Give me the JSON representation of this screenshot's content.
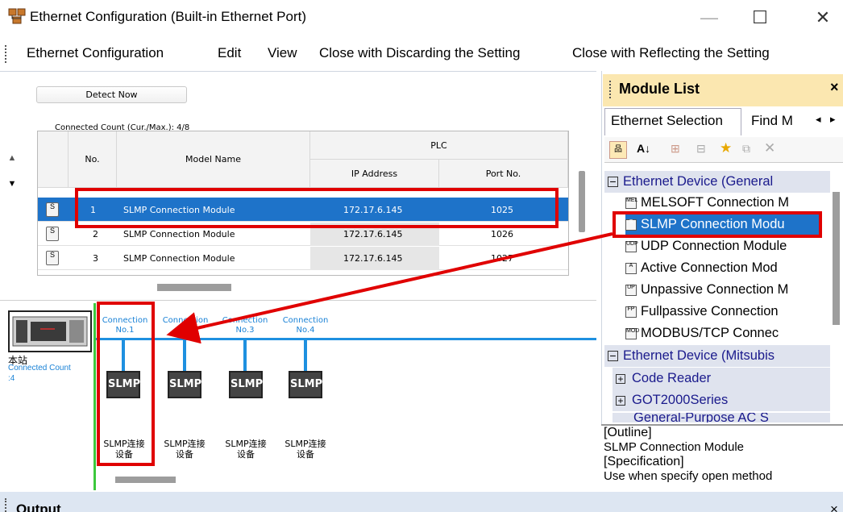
{
  "window": {
    "title": "Ethernet Configuration (Built-in Ethernet Port)",
    "minimize": "—",
    "maximize": "☐",
    "close": "✕"
  },
  "menu": [
    "Ethernet Configuration",
    "Edit",
    "View",
    "Close with Discarding the Setting",
    "Close with Reflecting the Setting"
  ],
  "config": {
    "detect_button": "Detect Now",
    "connected_count": "Connected Count (Cur./Max.):  4/8",
    "headers": {
      "no": "No.",
      "model": "Model Name",
      "plc": "PLC",
      "ip": "IP Address",
      "port": "Port No."
    },
    "rows": [
      {
        "no": "1",
        "model": "SLMP Connection Module",
        "ip": "172.17.6.145",
        "port": "1025",
        "icon": "S"
      },
      {
        "no": "2",
        "model": "SLMP Connection Module",
        "ip": "172.17.6.145",
        "port": "1026",
        "icon": "S"
      },
      {
        "no": "3",
        "model": "SLMP Connection Module",
        "ip": "172.17.6.145",
        "port": "1027",
        "icon": "S"
      }
    ]
  },
  "diagram": {
    "station": "本站",
    "connected_count": "Connected Count",
    "count_value": ":4",
    "connections": [
      {
        "label1": "Connection",
        "label2": "No.1",
        "box": "SLMP",
        "dev1": "SLMP连接",
        "dev2": "设备"
      },
      {
        "label1": "Connection",
        "label2": "No.2",
        "box": "SLMP",
        "dev1": "SLMP连接",
        "dev2": "设备"
      },
      {
        "label1": "Connection",
        "label2": "No.3",
        "box": "SLMP",
        "dev1": "SLMP连接",
        "dev2": "设备"
      },
      {
        "label1": "Connection",
        "label2": "No.4",
        "box": "SLMP",
        "dev1": "SLMP连接",
        "dev2": "设备"
      }
    ]
  },
  "module_list": {
    "title": "Module List",
    "close": "×",
    "tabs": [
      "Ethernet Selection",
      "Find M"
    ],
    "tab_prev": "◂",
    "tab_next": "▸",
    "category1": "Ethernet Device (General",
    "items": [
      {
        "label": "MELSOFT Connection M",
        "icon": "MEL"
      },
      {
        "label": "SLMP Connection Modu",
        "icon": "S"
      },
      {
        "label": "UDP Connection Module",
        "icon": "UDP"
      },
      {
        "label": "Active Connection Mod",
        "icon": "A"
      },
      {
        "label": "Unpassive Connection M",
        "icon": "UP"
      },
      {
        "label": "Fullpassive Connection",
        "icon": "FP"
      },
      {
        "label": "MODBUS/TCP Connec",
        "icon": "MOD"
      }
    ],
    "category2": "Ethernet Device (Mitsubis",
    "subitems": [
      "Code Reader",
      "GOT2000Series",
      "General-Purpose AC S"
    ],
    "outline_title": "[Outline]",
    "outline_text": "SLMP Connection Module",
    "spec_title": "[Specification]",
    "spec_text": "Use when specify open method"
  },
  "output": {
    "title": "Output",
    "close": "×"
  },
  "colors": {
    "selection": "#1e73c9",
    "accent_line": "#1e90e0",
    "highlight": "#e00000",
    "header_bg": "#fbe7b0"
  }
}
